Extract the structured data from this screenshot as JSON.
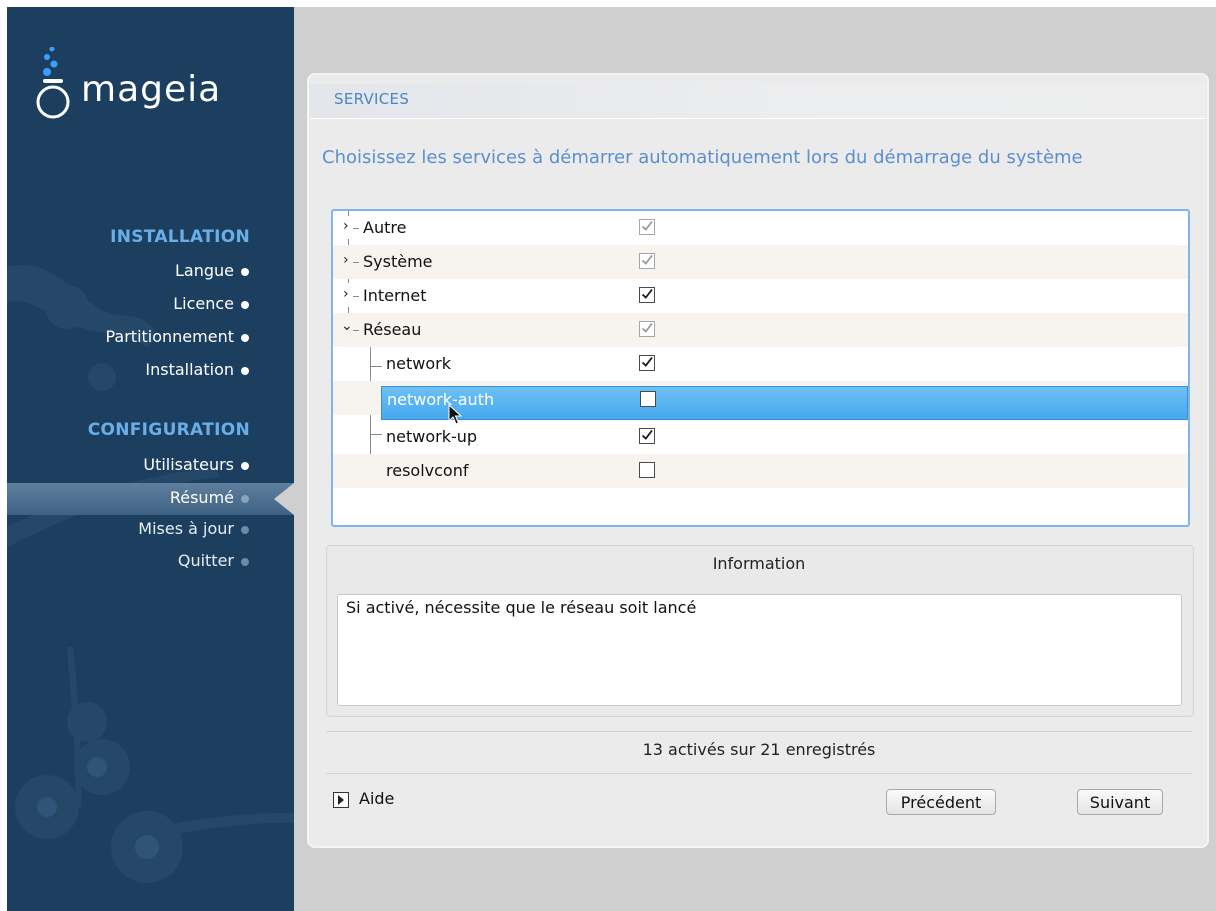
{
  "sidebar": {
    "brand": "mageia",
    "sections": [
      {
        "heading": "INSTALLATION",
        "items": [
          {
            "label": "Langue"
          },
          {
            "label": "Licence"
          },
          {
            "label": "Partitionnement"
          },
          {
            "label": "Installation"
          }
        ]
      },
      {
        "heading": "CONFIGURATION",
        "items": [
          {
            "label": "Utilisateurs"
          },
          {
            "label": "Résumé"
          },
          {
            "label": "Mises à jour"
          },
          {
            "label": "Quitter"
          }
        ]
      }
    ],
    "current_item": "Résumé"
  },
  "page": {
    "title": "SERVICES",
    "subtitle": "Choisissez les services à démarrer automatiquement lors du démarrage du système"
  },
  "tree": {
    "rows": [
      {
        "name": "Autre",
        "type": "group",
        "expanded": false,
        "checked": true,
        "inconsistent": true
      },
      {
        "name": "Système",
        "type": "group",
        "expanded": false,
        "checked": true,
        "inconsistent": true
      },
      {
        "name": "Internet",
        "type": "group",
        "expanded": false,
        "checked": true,
        "inconsistent": false
      },
      {
        "name": "Réseau",
        "type": "group",
        "expanded": true,
        "checked": true,
        "inconsistent": true
      },
      {
        "name": "network",
        "type": "service",
        "checked": true
      },
      {
        "name": "network-auth",
        "type": "service",
        "checked": false,
        "selected": true
      },
      {
        "name": "network-up",
        "type": "service",
        "checked": true
      },
      {
        "name": "resolvconf",
        "type": "service",
        "checked": false
      }
    ]
  },
  "info": {
    "title": "Information",
    "text": "Si activé, nécessite que le réseau soit lancé"
  },
  "status": "13 activés sur 21 enregistrés",
  "footer": {
    "help_label": "Aide",
    "prev_label": "Précédent",
    "next_label": "Suivant"
  },
  "colors": {
    "sidebar_bg": "#1d3f5f",
    "heading_accent": "#6aaee8",
    "title_accent": "#4a86c8",
    "selection": "#45a8ee"
  }
}
